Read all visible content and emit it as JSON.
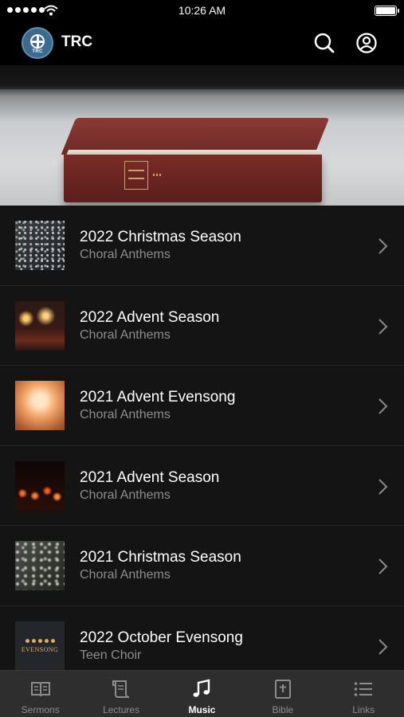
{
  "status_bar": {
    "time": "10:26 AM"
  },
  "header": {
    "title": "TRC",
    "logo_text": "TRC"
  },
  "list": [
    {
      "title": "2022 Christmas Season",
      "subtitle": "Choral Anthems",
      "thumb": "snow"
    },
    {
      "title": "2022 Advent Season",
      "subtitle": "Choral Anthems",
      "thumb": "candles"
    },
    {
      "title": "2021 Advent Evensong",
      "subtitle": "Choral Anthems",
      "thumb": "sunset"
    },
    {
      "title": "2021 Advent Season",
      "subtitle": "Choral Anthems",
      "thumb": "lights"
    },
    {
      "title": "2021 Christmas Season",
      "subtitle": "Choral Anthems",
      "thumb": "frost"
    },
    {
      "title": "2022 October Evensong",
      "subtitle": "Teen Choir",
      "thumb": "evensong",
      "thumb_text": "EVENSONG"
    }
  ],
  "tabs": [
    {
      "label": "Sermons",
      "icon": "open-book-icon",
      "active": false
    },
    {
      "label": "Lectures",
      "icon": "scroll-icon",
      "active": false
    },
    {
      "label": "Music",
      "icon": "music-note-icon",
      "active": true
    },
    {
      "label": "Bible",
      "icon": "bible-icon",
      "active": false
    },
    {
      "label": "Links",
      "icon": "list-icon",
      "active": false
    }
  ],
  "colors": {
    "background": "#141414",
    "tabbar": "#2e2e2e",
    "subtitle": "#8d8d8d",
    "active_tab": "#ffffff",
    "inactive_tab": "#8c8c8c"
  }
}
